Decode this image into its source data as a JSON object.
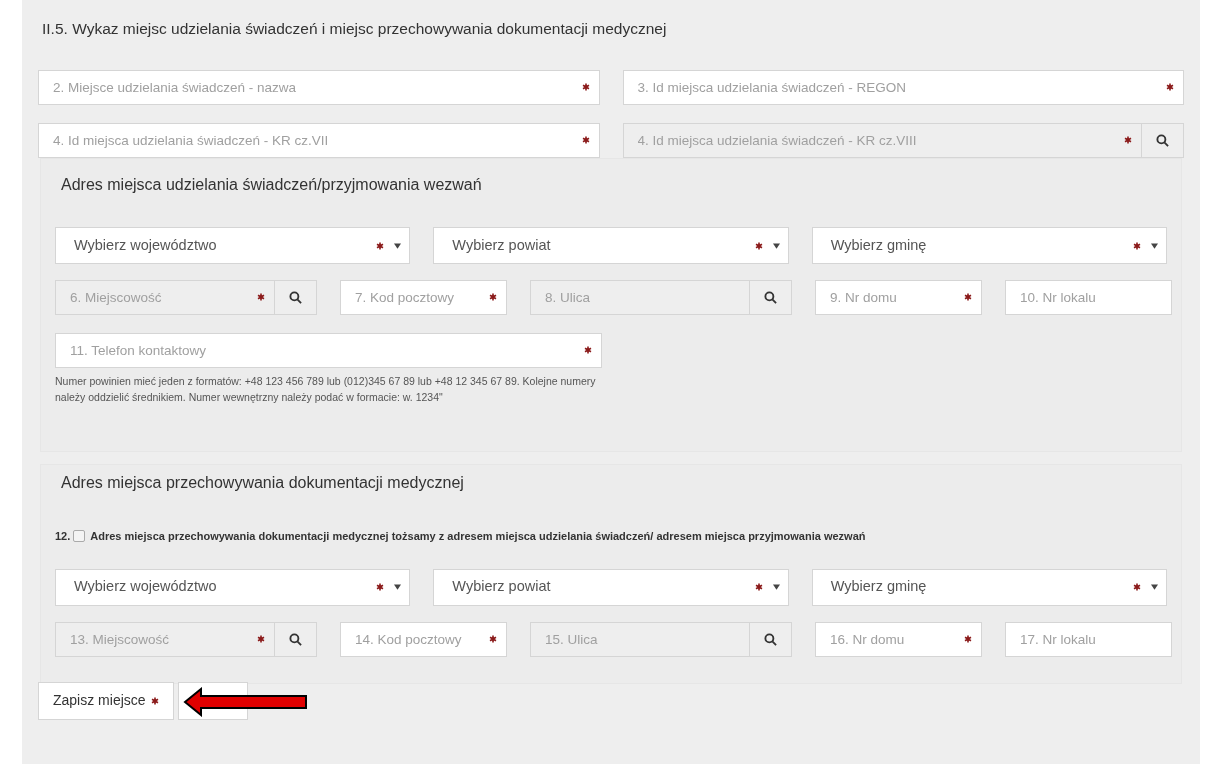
{
  "heading": "II.5. Wykaz miejsc udzielania świadczeń i miejsc przechowywania dokumentacji medycznej",
  "top_fields": [
    {
      "placeholder": "2. Miejsce udzielania świadczeń - nazwa",
      "required": true,
      "disabled": false,
      "search": false
    },
    {
      "placeholder": "3. Id miejsca udzielania świadczeń - REGON",
      "required": true,
      "disabled": false,
      "search": false
    },
    {
      "placeholder": "4. Id miejsca udzielania świadczeń - KR cz.VII",
      "required": true,
      "disabled": false,
      "search": false
    },
    {
      "placeholder": "4. Id miejsca udzielania świadczeń - KR cz.VIII",
      "required": true,
      "disabled": true,
      "search": true
    }
  ],
  "sections": [
    {
      "title": "Adres miejsca udzielania świadczeń/przyjmowania wezwań",
      "selects": [
        {
          "placeholder": "Wybierz województwo",
          "required": true
        },
        {
          "placeholder": "Wybierz powiat",
          "required": true
        },
        {
          "placeholder": "Wybierz gminę",
          "required": true
        }
      ],
      "fields": [
        {
          "placeholder": "6. Miejscowość",
          "required": true,
          "disabled": true,
          "search": true
        },
        {
          "placeholder": "7. Kod pocztowy",
          "required": true,
          "disabled": false,
          "search": false
        },
        {
          "placeholder": "8. Ulica",
          "required": false,
          "disabled": true,
          "search": true
        },
        {
          "placeholder": "9. Nr domu",
          "required": true,
          "disabled": false,
          "search": false
        },
        {
          "placeholder": "10. Nr lokalu",
          "required": false,
          "disabled": false,
          "search": false
        }
      ],
      "phone": {
        "placeholder": "11. Telefon kontaktowy",
        "required": true,
        "disabled": false,
        "search": false,
        "hint": "Numer powinien mieć jeden z formatów: +48 123 456 789 lub (012)345 67 89 lub +48 12 345 67 89. Kolejne numery należy oddzielić średnikiem. Numer wewnętrzny należy podać w formacie: w. 1234\""
      }
    },
    {
      "title": "Adres miejsca przechowywania dokumentacji medycznej",
      "checkbox": {
        "number": "12.",
        "label": "Adres miejsca przechowywania dokumentacji medycznej tożsamy z adresem miejsca udzielania świadczeń/ adresem miejsca przyjmowania wezwań",
        "checked": false
      },
      "selects": [
        {
          "placeholder": "Wybierz województwo",
          "required": true
        },
        {
          "placeholder": "Wybierz powiat",
          "required": true
        },
        {
          "placeholder": "Wybierz gminę",
          "required": true
        }
      ],
      "fields": [
        {
          "placeholder": "13. Miejscowość",
          "required": true,
          "disabled": true,
          "search": true
        },
        {
          "placeholder": "14. Kod pocztowy",
          "required": true,
          "disabled": false,
          "search": false
        },
        {
          "placeholder": "15. Ulica",
          "required": false,
          "disabled": true,
          "search": true
        },
        {
          "placeholder": "16. Nr domu",
          "required": true,
          "disabled": false,
          "search": false
        },
        {
          "placeholder": "17. Nr lokalu",
          "required": false,
          "disabled": false,
          "search": false
        }
      ]
    }
  ],
  "save_button": {
    "label": "Zapisz miejsce",
    "required": true
  }
}
